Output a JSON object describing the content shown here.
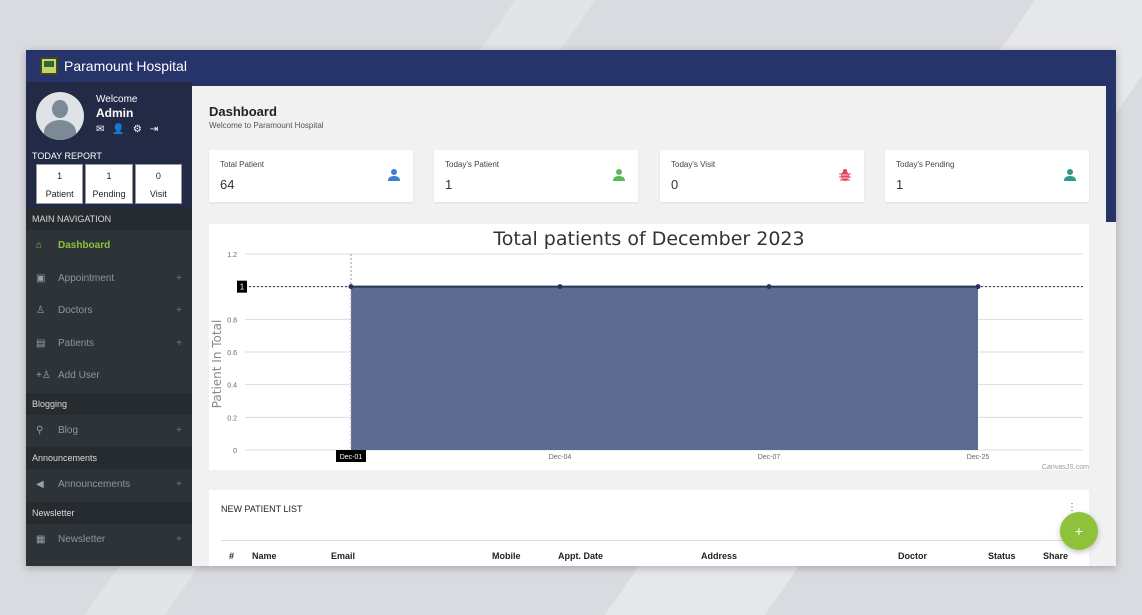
{
  "app": {
    "title": "Paramount Hospital",
    "logo_icon": "hospital-logo-icon"
  },
  "user": {
    "welcome": "Welcome",
    "name": "Admin",
    "icons": [
      "mail-icon",
      "user-icon",
      "gear-icon",
      "logout-icon"
    ]
  },
  "today_report": {
    "title": "TODAY REPORT",
    "cells": [
      {
        "value": "1",
        "label": "Patient"
      },
      {
        "value": "1",
        "label": "Pending"
      },
      {
        "value": "0",
        "label": "Visit"
      }
    ]
  },
  "sidebar": {
    "main_nav": "MAIN NAVIGATION",
    "items": [
      {
        "label": "Dashboard",
        "icon": "home-icon",
        "active": true,
        "plus": ""
      },
      {
        "label": "Appointment",
        "icon": "calendar-icon",
        "plus": "+"
      },
      {
        "label": "Doctors",
        "icon": "doctor-icon",
        "plus": "+"
      },
      {
        "label": "Patients",
        "icon": "patients-icon",
        "plus": "+"
      },
      {
        "label": "Add User",
        "icon": "add-user-icon",
        "plus": ""
      }
    ],
    "blogging": "Blogging",
    "blog": {
      "label": "Blog",
      "icon": "blog-icon",
      "plus": "+"
    },
    "announcements_h": "Announcements",
    "announcements": {
      "label": "Announcements",
      "icon": "megaphone-icon",
      "plus": "+"
    },
    "newsletter_h": "Newsletter",
    "newsletter": {
      "label": "Newsletter",
      "icon": "newsletter-icon",
      "plus": "+"
    }
  },
  "page": {
    "title": "Dashboard",
    "subtitle": "Welcome to Paramount Hospital"
  },
  "stats": [
    {
      "label": "Total Patient",
      "value": "64",
      "icon": "user-icon",
      "color": "#3b7fd0"
    },
    {
      "label": "Today's Patient",
      "value": "1",
      "icon": "user-icon",
      "color": "#5cb85c"
    },
    {
      "label": "Today's Visit",
      "value": "0",
      "icon": "bug-icon",
      "color": "#e8435a"
    },
    {
      "label": "Today's Pending",
      "value": "1",
      "icon": "user-icon",
      "color": "#2e9a8a"
    }
  ],
  "chart_data": {
    "type": "area",
    "title": "Total patients of December 2023",
    "ylabel": "Patient In Total",
    "xlabel": "",
    "categories": [
      "Dec-01",
      "Dec-04",
      "Dec-07",
      "Dec-25"
    ],
    "values": [
      1,
      1,
      1,
      1
    ],
    "ylim": [
      0,
      1.2
    ],
    "yticks": [
      "0",
      "0.2",
      "0.4",
      "0.6",
      "0.8",
      "1",
      "1.2"
    ],
    "crosshair_label": "1",
    "highlight_category": "Dec-01",
    "grid": true,
    "fill_color": "#5d6b90",
    "line_color": "#26355f",
    "credit": "CanvasJS.com"
  },
  "patient_list": {
    "title": "NEW PATIENT LIST",
    "menu": "⋮",
    "columns": [
      "#",
      "Name",
      "Email",
      "Mobile",
      "Appt. Date",
      "Address",
      "Doctor",
      "Status",
      "Share"
    ]
  },
  "fab_label": "+"
}
